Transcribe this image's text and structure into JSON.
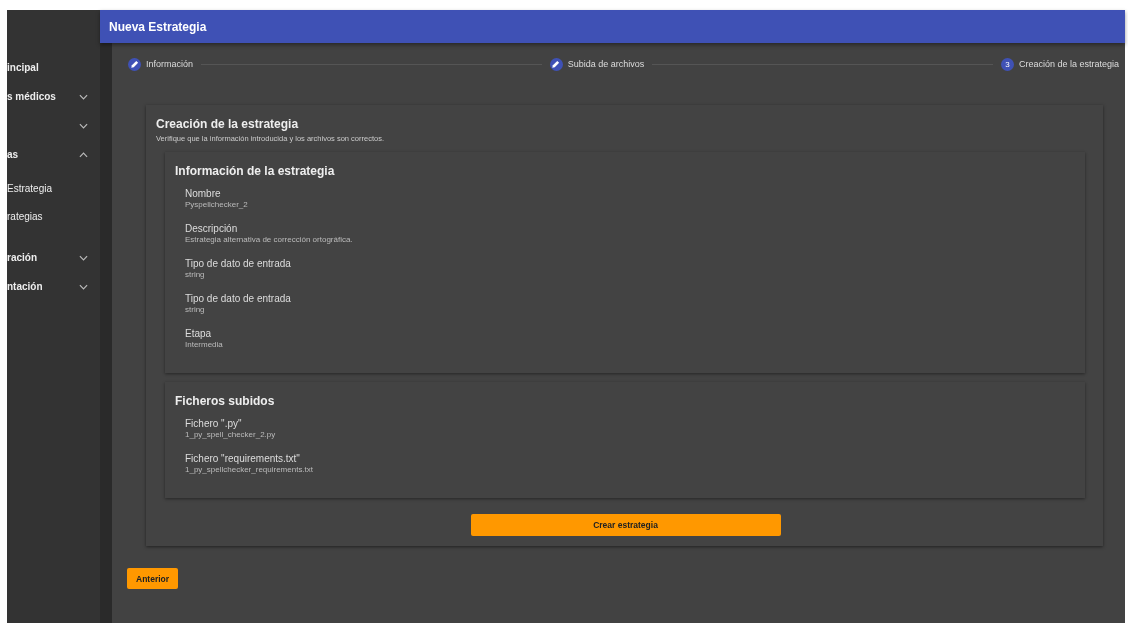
{
  "sidebar": {
    "items": [
      {
        "label": "incipal"
      },
      {
        "label": "s médicos",
        "expanded": false
      },
      {
        "expanded": false
      },
      {
        "label": "as",
        "expanded": true,
        "children": [
          {
            "label": "Estrategia"
          },
          {
            "label": "rategias"
          }
        ]
      },
      {
        "label": "ración",
        "expanded": false
      },
      {
        "label": "ntación",
        "expanded": false
      }
    ]
  },
  "header": {
    "title": "Nueva Estrategia"
  },
  "stepper": [
    {
      "kind": "edit",
      "label": "Información"
    },
    {
      "kind": "edit",
      "label": "Subida de archivos"
    },
    {
      "kind": "number",
      "number": "3",
      "label": "Creación de la estrategia"
    }
  ],
  "card": {
    "title": "Creación de la estrategia",
    "subtitle": "Verifique que la información introducida y los archivos son correctos.",
    "sections": [
      {
        "title": "Información de la estrategia",
        "fields": [
          {
            "label": "Nombre",
            "value": "Pyspellchecker_2"
          },
          {
            "label": "Descripción",
            "value": "Estrategia alternativa de corrección ortográfica."
          },
          {
            "label": "Tipo de dato de entrada",
            "value": "string"
          },
          {
            "label": "Tipo de dato de entrada",
            "value": "string"
          },
          {
            "label": "Etapa",
            "value": "Intermedia"
          }
        ]
      },
      {
        "title": "Ficheros subidos",
        "fields": [
          {
            "label": "Fichero \".py\"",
            "value": "1_py_spell_checker_2.py"
          },
          {
            "label": "Fichero \"requirements.txt\"",
            "value": "1_py_spellchecker_requirements.txt"
          }
        ]
      }
    ],
    "submit": "Crear estrategia"
  },
  "back_button": "Anterior"
}
